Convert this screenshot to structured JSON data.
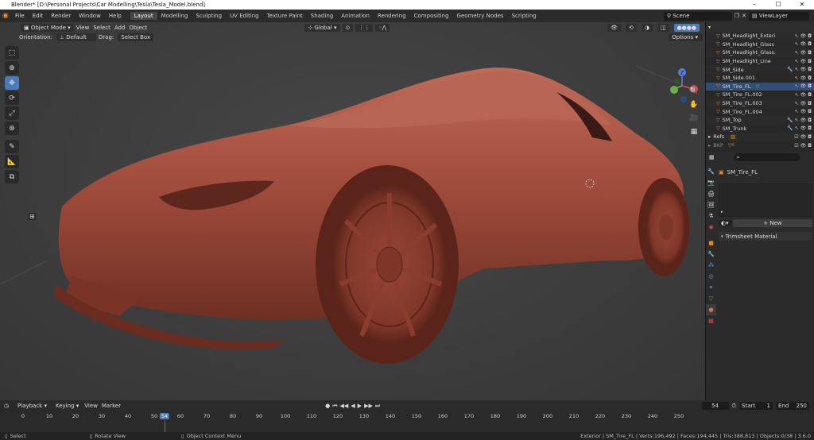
{
  "title": "Blender* [D:\\Personal Projects\\Car Modelling\\Tesla\\Tesla_Model.blend]",
  "window_controls": [
    "–",
    "☐",
    "✕"
  ],
  "menu": [
    "File",
    "Edit",
    "Render",
    "Window",
    "Help"
  ],
  "workspaces": [
    "Layout",
    "Modelling",
    "Sculpting",
    "UV Editing",
    "Texture Paint",
    "Shading",
    "Animation",
    "Rendering",
    "Compositing",
    "Geometry Nodes",
    "Scripting"
  ],
  "scene": {
    "label": "Scene",
    "view_layer": "ViewLayer"
  },
  "viewport": {
    "mode": "Object Mode",
    "view": "View",
    "select": "Select",
    "add": "Add",
    "object": "Object",
    "orientation": "Global",
    "options": "Options",
    "orientation_label": "Orientation:",
    "orientation_value": "Default",
    "drag_label": "Drag:",
    "drag_value": "Select Box"
  },
  "outliner": {
    "items": [
      {
        "name": "SM_Headlight_Exteri"
      },
      {
        "name": "SM_Headlight_Glass"
      },
      {
        "name": "SM_Headlight_Glass."
      },
      {
        "name": "SM_Headlight_Line"
      },
      {
        "name": "SM_Side"
      },
      {
        "name": "SM_Side.001"
      },
      {
        "name": "SM_Tire_FL"
      },
      {
        "name": "SM_Tire_FL.002"
      },
      {
        "name": "SM_Tire_FL.003"
      },
      {
        "name": "SM_Tire_FL.004"
      },
      {
        "name": "SM_Top"
      },
      {
        "name": "SM_Trunk"
      },
      {
        "name": "Refs"
      },
      {
        "name": "BKP"
      }
    ],
    "bkp_count": "6"
  },
  "properties": {
    "object_name": "SM_Tire_FL",
    "new_label": "New",
    "material_panel": "Trimsheet Material"
  },
  "timeline": {
    "playback": "Playback",
    "keying": "Keying",
    "view": "View",
    "marker": "Marker",
    "current_frame": "54",
    "start_label": "Start",
    "start": "1",
    "end_label": "End",
    "end": "250",
    "ticks": [
      "0",
      "10",
      "20",
      "30",
      "40",
      "50",
      "54",
      "60",
      "70",
      "80",
      "90",
      "100",
      "110",
      "120",
      "130",
      "140",
      "150",
      "160",
      "170",
      "180",
      "190",
      "200",
      "210",
      "220",
      "230",
      "240",
      "250"
    ]
  },
  "status": {
    "select": "Select",
    "rotate": "Rotate View",
    "context": "Object Context Menu",
    "info": "Exterior | SM_Tire_FL | Verts:196,492 | Faces:194,445 | Tris:388,813 | Objects:0/38 | 3.6.0"
  }
}
